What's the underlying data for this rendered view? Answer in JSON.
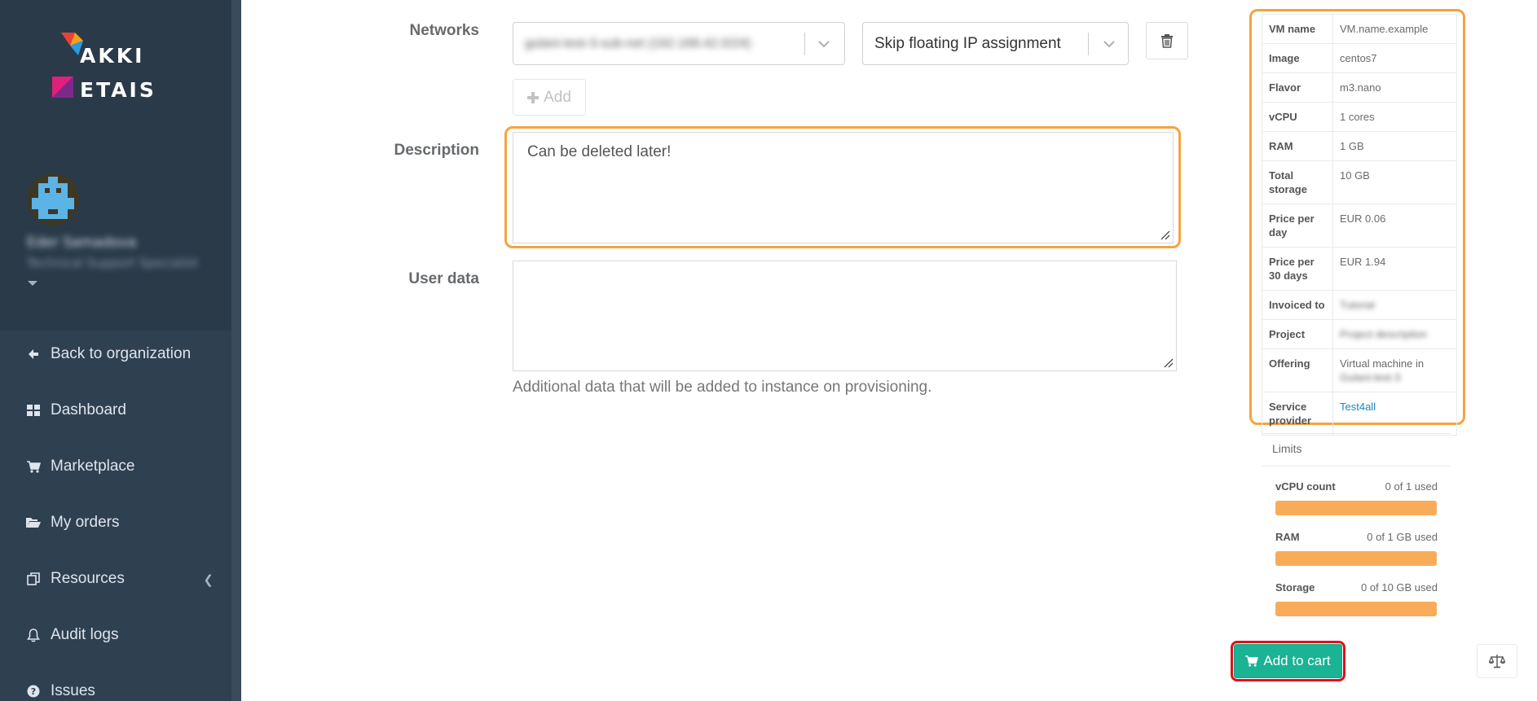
{
  "sidebar": {
    "logo_top": "AKKI",
    "logo_bottom": "ETAIS",
    "user_name": "Eder Samadova",
    "user_role": "Technical Support Specialist",
    "items": [
      {
        "label": "Back to organization",
        "icon": "arrow-left-icon"
      },
      {
        "label": "Dashboard",
        "icon": "dashboard-icon"
      },
      {
        "label": "Marketplace",
        "icon": "cart-icon"
      },
      {
        "label": "My orders",
        "icon": "folder-open-icon"
      },
      {
        "label": "Resources",
        "icon": "resources-icon"
      },
      {
        "label": "Audit logs",
        "icon": "bell-icon"
      },
      {
        "label": "Issues",
        "icon": "question-circle-icon"
      }
    ]
  },
  "form": {
    "networks_label": "Networks",
    "network_value": "gulani-test-3-sub-net (192.168.42.0/24)",
    "floating_ip_value": "Skip floating IP assignment",
    "add_label": "Add",
    "description_label": "Description",
    "description_value": "Can be deleted later!",
    "user_data_label": "User data",
    "user_data_value": "",
    "user_data_help": "Additional data that will be added to instance on provisioning."
  },
  "summary": {
    "rows": [
      {
        "key": "VM name",
        "value": "VM.name.example"
      },
      {
        "key": "Image",
        "value": "centos7"
      },
      {
        "key": "Flavor",
        "value": "m3.nano"
      },
      {
        "key": "vCPU",
        "value": "1 cores"
      },
      {
        "key": "RAM",
        "value": "1 GB"
      },
      {
        "key": "Total storage",
        "value": "10 GB"
      },
      {
        "key": "Price per day",
        "value": "EUR 0.06"
      },
      {
        "key": "Price per 30 days",
        "value": "EUR 1.94"
      },
      {
        "key": "Invoiced to",
        "value": "Tutorial"
      },
      {
        "key": "Project",
        "value": "Project description"
      },
      {
        "key": "Offering",
        "value": "Virtual machine in",
        "value_extra": "Gulani-test-3"
      },
      {
        "key": "Service provider",
        "value": "Test4all"
      }
    ]
  },
  "limits": {
    "title": "Limits",
    "items": [
      {
        "label": "vCPU count",
        "usage": "0 of 1 used",
        "fraction": 0
      },
      {
        "label": "RAM",
        "usage": "0 of 1 GB used",
        "fraction": 0
      },
      {
        "label": "Storage",
        "usage": "0 of 10 GB used",
        "fraction": 0
      }
    ]
  },
  "actions": {
    "add_to_cart_label": "Add to cart"
  },
  "colors": {
    "sidebar_bg": "#2f4050",
    "accent_green": "#1ab394",
    "highlight_orange": "#f5a341",
    "highlight_red": "#e0101e",
    "limit_bar": "#f8ac59"
  }
}
